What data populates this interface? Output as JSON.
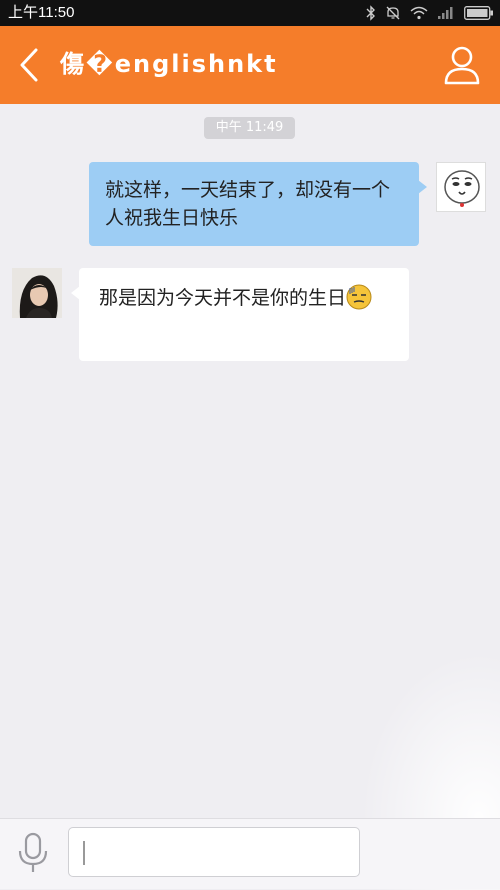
{
  "status_bar": {
    "time": "上午11:50",
    "icons": [
      "bluetooth-icon",
      "mute-icon",
      "wifi-icon",
      "signal-icon",
      "battery-icon"
    ]
  },
  "header": {
    "title": "傷�englishnkt",
    "back_icon": "chevron-left-icon",
    "profile_icon": "person-icon",
    "color": "#f57d2a"
  },
  "chat": {
    "timestamp": "中午 11:49",
    "messages": [
      {
        "sender": "me",
        "text": "就这样，一天结束了，却没有一个人祝我生日快乐",
        "bubble_color": "#9dcdf4"
      },
      {
        "sender": "other",
        "text": "那是因为今天并不是你的生日",
        "emoji": "smirk-emoji-icon",
        "bubble_color": "#ffffff"
      }
    ]
  },
  "input_bar": {
    "voice_icon": "microphone-icon",
    "input_value": ""
  }
}
